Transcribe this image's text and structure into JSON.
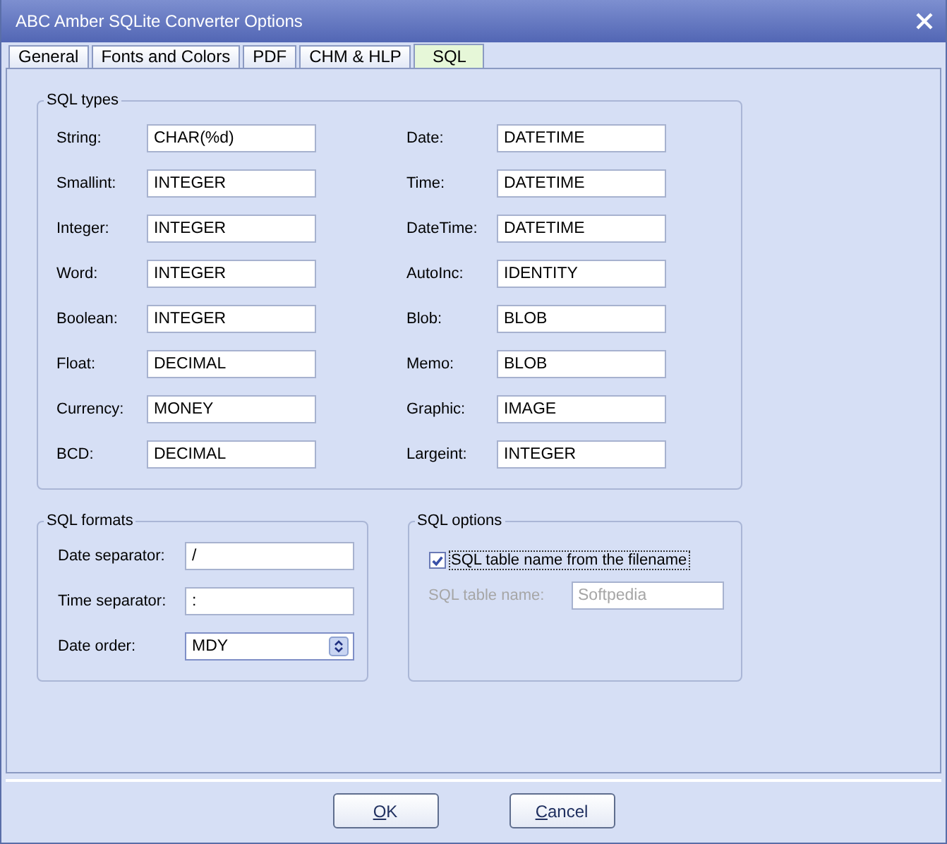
{
  "window": {
    "title": "ABC Amber SQLite Converter Options"
  },
  "tabs": [
    {
      "label": "General",
      "selected": false
    },
    {
      "label": "Fonts and Colors",
      "selected": false
    },
    {
      "label": "PDF",
      "selected": false
    },
    {
      "label": "CHM & HLP",
      "selected": false
    },
    {
      "label": "SQL",
      "selected": true
    }
  ],
  "sql_types": {
    "title": "SQL types",
    "left": [
      {
        "label": "String:",
        "value": "CHAR(%d)"
      },
      {
        "label": "Smallint:",
        "value": "INTEGER"
      },
      {
        "label": "Integer:",
        "value": "INTEGER"
      },
      {
        "label": "Word:",
        "value": "INTEGER"
      },
      {
        "label": "Boolean:",
        "value": "INTEGER"
      },
      {
        "label": "Float:",
        "value": "DECIMAL"
      },
      {
        "label": "Currency:",
        "value": "MONEY"
      },
      {
        "label": "BCD:",
        "value": "DECIMAL"
      }
    ],
    "right": [
      {
        "label": "Date:",
        "value": "DATETIME"
      },
      {
        "label": "Time:",
        "value": "DATETIME"
      },
      {
        "label": "DateTime:",
        "value": "DATETIME"
      },
      {
        "label": "AutoInc:",
        "value": "IDENTITY"
      },
      {
        "label": "Blob:",
        "value": "BLOB"
      },
      {
        "label": "Memo:",
        "value": "BLOB"
      },
      {
        "label": "Graphic:",
        "value": "IMAGE"
      },
      {
        "label": "Largeint:",
        "value": "INTEGER"
      }
    ]
  },
  "sql_formats": {
    "title": "SQL formats",
    "fields": [
      {
        "kind": "text",
        "label": "Date separator:",
        "value": "/"
      },
      {
        "kind": "text",
        "label": "Time separator:",
        "value": ":"
      },
      {
        "kind": "select",
        "label": "Date order:",
        "value": "MDY"
      }
    ]
  },
  "sql_options": {
    "title": "SQL options",
    "checkbox": {
      "label": "SQL table name from the filename",
      "checked": true
    },
    "table_name": {
      "label": "SQL table name:",
      "value": "Softpedia",
      "disabled": true
    }
  },
  "buttons": [
    "OK",
    "Cancel"
  ]
}
